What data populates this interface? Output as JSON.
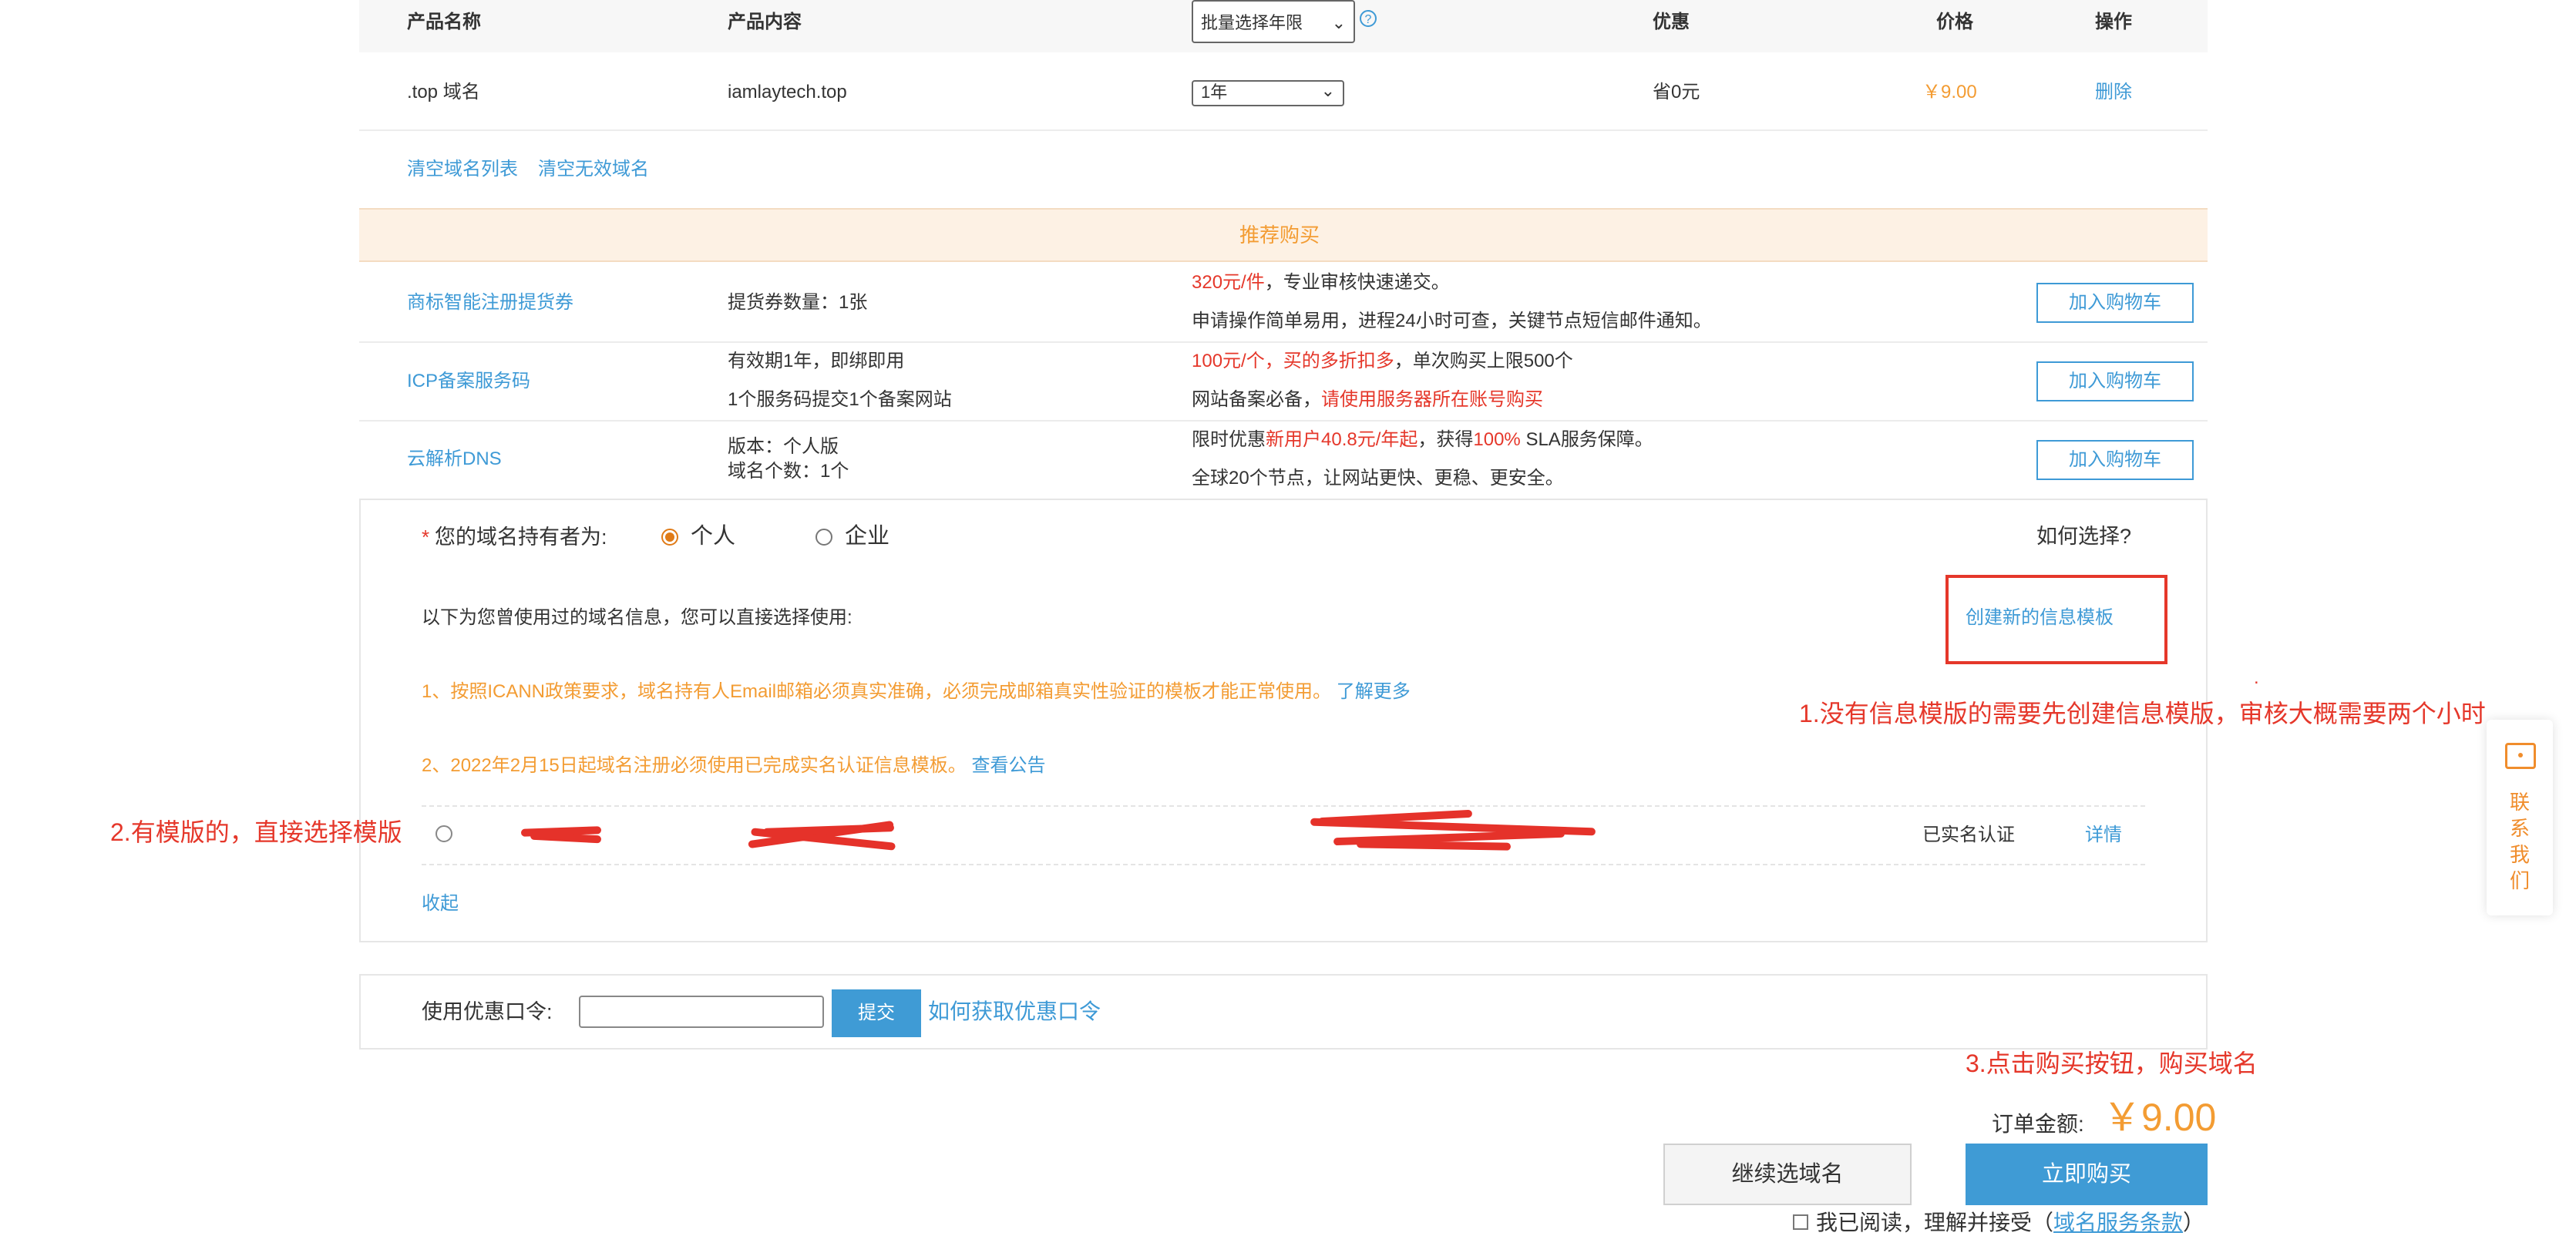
{
  "table": {
    "headers": {
      "product_name": "产品名称",
      "product_content": "产品内容",
      "period_select": "批量选择年限",
      "discount": "优惠",
      "price": "价格",
      "action": "操作"
    },
    "row": {
      "name": ".top 域名",
      "content": "iamlaytech.top",
      "period": "1年",
      "discount": "省0元",
      "price": "￥9.00",
      "delete": "删除"
    },
    "links": {
      "clear_list": "清空域名列表",
      "clear_invalid": "清空无效域名"
    }
  },
  "recommend": {
    "title": "推荐购买",
    "add_label": "加入购物车",
    "items": [
      {
        "name": "商标智能注册提货券",
        "detail1": "提货券数量：1张",
        "detail2": "",
        "desc1_red": "320元/件",
        "desc1_rest": "，专业审核快速递交。",
        "desc2": "申请操作简单易用，进程24小时可查，关键节点短信邮件通知。"
      },
      {
        "name": "ICP备案服务码",
        "detail1": "有效期1年，即绑即用",
        "detail2": "1个服务码提交1个备案网站",
        "desc1_red": "100元/个，买的多折扣多",
        "desc1_rest": "，单次购买上限500个",
        "desc2_plain": "网站备案必备，",
        "desc2_red": "请使用服务器所在账号购买"
      },
      {
        "name": "云解析DNS",
        "detail1": "版本：个人版",
        "detail2": "域名个数：1个",
        "desc1_a": "限时优惠",
        "desc1_b": "新用户40.8元/年起",
        "desc1_c": "，获得",
        "desc1_d": "100%",
        "desc1_e": " SLA服务保障。",
        "desc2": "全球20个节点，让网站更快、更稳、更安全。"
      }
    ]
  },
  "holder": {
    "required_mark": "*",
    "label": "您的域名持有者为:",
    "option_personal": "个人",
    "option_company": "企业",
    "how_to_choose": "如何选择?",
    "intro": "以下为您曾使用过的域名信息，您可以直接选择使用:",
    "create_template": "创建新的信息模板",
    "notice1": "1、按照ICANN政策要求，域名持有人Email邮箱必须真实准确，必须完成邮箱真实性验证的模板才能正常使用。",
    "notice1_link": "了解更多",
    "notice2": "2、2022年2月15日起域名注册必须使用已完成实名认证信息模板。",
    "notice2_link": "查看公告",
    "template_row": {
      "status": "已实名认证",
      "details": "详情"
    },
    "collapse": "收起"
  },
  "coupon": {
    "label": "使用优惠口令:",
    "input_value": "",
    "submit": "提交",
    "how_link": "如何获取优惠口令"
  },
  "order": {
    "total_label": "订单金额:",
    "total_value": "￥9.00",
    "continue_button": "继续选域名",
    "buy_button": "立即购买",
    "agree_text": "我已阅读，理解并接受",
    "agree_link_prefix": "（",
    "agree_link": "域名服务条款",
    "agree_link_suffix": "）"
  },
  "annotations": {
    "note1": "1.没有信息模版的需要先创建信息模版，审核大概需要两个小时",
    "note2": "2.有模版的，直接选择模版",
    "note3": "3.点击购买按钮，购买域名",
    "dot": "."
  },
  "float_contact": {
    "label_chars": [
      "联",
      "系",
      "我",
      "们"
    ]
  },
  "colors": {
    "accent_blue": "#3e9ad6",
    "price_orange": "#f39c33",
    "annotation_red": "#e5372a",
    "recommend_bg": "#fdf1e4",
    "buy_button": "#3f9bd5"
  }
}
